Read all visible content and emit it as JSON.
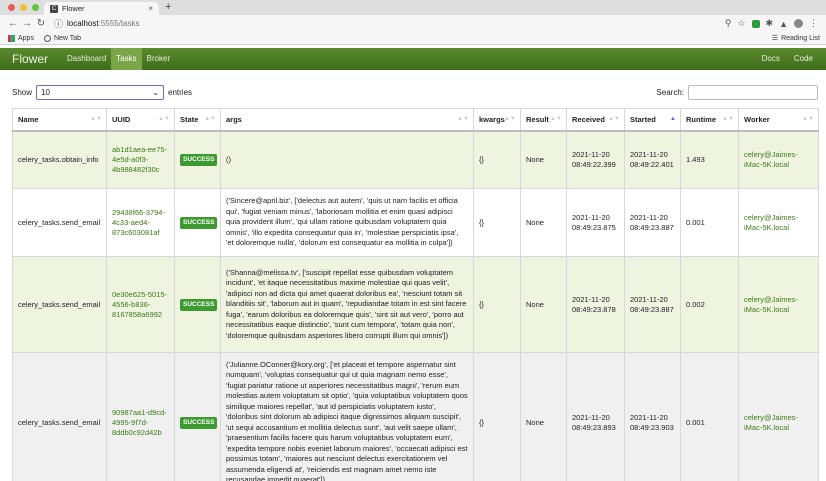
{
  "browser": {
    "tab_title": "Flower",
    "url_host": "localhost",
    "url_path": ":5555/tasks",
    "bookmarks": [
      "Apps",
      "New Tab"
    ],
    "reading_list": "Reading List"
  },
  "navbar": {
    "brand": "Flower",
    "links": [
      "Dashboard",
      "Tasks",
      "Broker"
    ],
    "right_links": [
      "Docs",
      "Code"
    ]
  },
  "controls": {
    "show_label": "Show",
    "entries_value": "10",
    "entries_label": "entries",
    "search_label": "Search:"
  },
  "table": {
    "columns": [
      "Name",
      "UUID",
      "State",
      "args",
      "kwargs",
      "Result",
      "Received",
      "Started",
      "Runtime",
      "Worker"
    ],
    "rows": [
      {
        "name": "celery_tasks.obtain_info",
        "uuid": "ab1d1aea-ee75-4e5d-a0f3-4b988482f30c",
        "state": "SUCCESS",
        "args": "()",
        "kwargs": "{}",
        "result": "None",
        "received": "2021-11-20 08:49:22.399",
        "started": "2021-11-20 08:49:22.401",
        "runtime": "1.493",
        "worker": "celery@Jaimes-iMac-5K.local"
      },
      {
        "name": "celery_tasks.send_email",
        "uuid": "29438f66-3794-4c33-aed4-873c603081af",
        "state": "SUCCESS",
        "args": "('Sincere@april.biz', ['delectus aut autem', 'quis ut nam facilis et officia qui', 'fugiat veniam minus', 'laboriosam mollitia et enim quasi adipisci quia provident illum', 'qui ullam ratione quibusdam voluptatem quia omnis', 'illo expedita consequatur quia in', 'molestiae perspiciatis ipsa', 'et doloremque nulla', 'dolorum est consequatur ea mollitia in culpa'])",
        "kwargs": "{}",
        "result": "None",
        "received": "2021-11-20 08:49:23.875",
        "started": "2021-11-20 08:49:23.887",
        "runtime": "0.001",
        "worker": "celery@Jaimes-iMac-5K.local"
      },
      {
        "name": "celery_tasks.send_email",
        "uuid": "0e30e625-5015-4556-b836-8167858a6992",
        "state": "SUCCESS",
        "args": "('Shanna@melissa.tv', ['suscipit repellat esse quibusdam voluptatem incidunt', 'et itaque necessitatibus maxime molestiae qui quas velit', 'adipisci non ad dicta qui amet quaerat doloribus ea', 'nesciunt totam sit blanditiis sit', 'laborum aut in quam', 'repudiandae totam in est sint facere fuga', 'earum doloribus ea doloremque quis', 'sint sit aut vero', 'porro aut necessitatibus eaque distinctio', 'sunt cum tempora', 'totam quia non', 'doloremque quibusdam asperiores libero corrupti illum qui omnis'])",
        "kwargs": "{}",
        "result": "None",
        "received": "2021-11-20 08:49:23.878",
        "started": "2021-11-20 08:49:23.887",
        "runtime": "0.002",
        "worker": "celery@Jaimes-iMac-5K.local"
      },
      {
        "name": "celery_tasks.send_email",
        "uuid": "90987aa1-d9cd-4995-9f7d-8ddb0c92d42b",
        "state": "SUCCESS",
        "args": "('Julianne.OConner@kory.org', ['et placeat et tempore aspernatur sint numquam', 'voluptas consequatur qui ut quia magnam nemo esse', 'fugiat pariatur ratione ut asperiores necessitatibus magni', 'rerum eum molestias autem voluptatum sit optio', 'quia voluptatibus voluptatem quos similique maiores repellat', 'aut id perspiciatis voluptatem iusto', 'doloribus sint dolorum ab adipisci itaque dignissimos aliquam suscipit', 'ut sequi accusantium et mollitia delectus sunt', 'aut velit saepe ullam', 'praesentium facilis facere quis harum voluptatibus voluptatem eum', 'expedita tempore nobis eveniet laborum maiores', 'occaecati adipisci est possimus totam', 'maiores aut nesciunt delectus exercitationem vel assumenda eligendi at', 'reiciendis est magnam amet nemo iste recusandae impedit quaerat'])",
        "kwargs": "{}",
        "result": "None",
        "received": "2021-11-20 08:49:23.893",
        "started": "2021-11-20 08:49:23.903",
        "runtime": "0.001",
        "worker": "celery@Jaimes-iMac-5K.local"
      }
    ]
  },
  "colors": {
    "navbar": "#4a7a22",
    "nav_active": "#7aa648",
    "row_highlight": "#eef4df",
    "badge": "#3c9a30",
    "link_green": "#3d7a16"
  }
}
